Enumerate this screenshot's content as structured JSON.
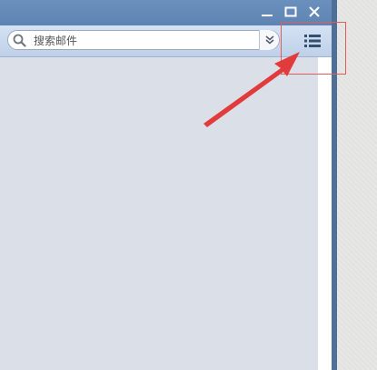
{
  "window": {
    "controls": {
      "minimize": "minimize-icon",
      "maximize": "maximize-icon",
      "close": "close-icon"
    }
  },
  "toolbar": {
    "search": {
      "placeholder": "搜索邮件",
      "value": "",
      "search_icon": "search-icon",
      "options_icon": "double-chevron-down-icon"
    },
    "menu_icon": "list-menu-icon"
  },
  "annotation": {
    "color": "#e23b3b",
    "arrow_icon": "arrow-icon"
  },
  "colors": {
    "titlebar": "#5e84b3",
    "toolbar": "#c7d7ec",
    "content": "#dbe0e8",
    "frame": "#4e6f97"
  }
}
